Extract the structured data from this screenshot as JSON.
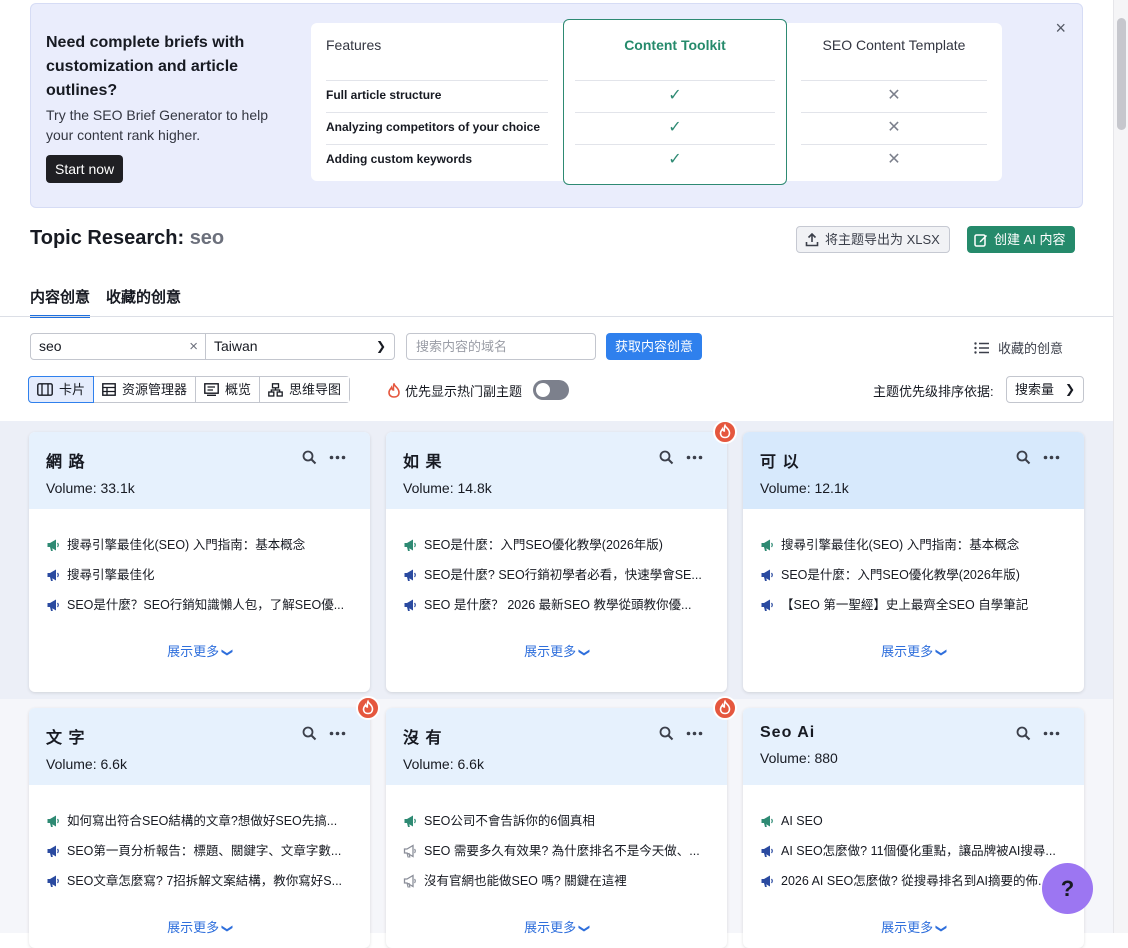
{
  "banner": {
    "headline": "Need complete briefs with customization and article outlines?",
    "sub": "Try the SEO Brief Generator to help your content rank higher.",
    "start_label": "Start now",
    "close": "×",
    "compare": {
      "features_header": "Features",
      "toolkit_header": "Content Toolkit",
      "template_header": "SEO Content Template",
      "rows": [
        "Full article structure",
        "Analyzing competitors of your choice",
        "Adding custom keywords"
      ],
      "check": "✓",
      "cross": "✕"
    }
  },
  "title": {
    "prefix": "Topic Research:",
    "keyword": "seo"
  },
  "actions": {
    "export_label": "将主题导出为 XLSX",
    "create_label": "创建 AI 内容"
  },
  "tabs": [
    "内容创意",
    "收藏的创意"
  ],
  "filters": {
    "search_value": "seo",
    "clear": "×",
    "country": "Taiwan",
    "domain_placeholder": "搜索内容的域名",
    "get_label": "获取内容创意",
    "saved_label": "收藏的创意"
  },
  "views": [
    "卡片",
    "资源管理器",
    "概览",
    "思维导图"
  ],
  "hot_label": "优先显示热门副主题",
  "sort": {
    "label": "主题优先级排序依据:",
    "value": "搜索量"
  },
  "show_more": "展示更多",
  "cards": [
    {
      "topic": "網 路",
      "volume": "Volume: 33.1k",
      "items": [
        "搜尋引擎最佳化(SEO) 入門指南：基本概念",
        "搜尋引擎最佳化",
        "SEO是什麼？SEO行銷知識懶人包，了解SEO優..."
      ]
    },
    {
      "topic": "如 果",
      "volume": "Volume: 14.8k",
      "items": [
        "SEO是什麼：入門SEO優化教學(2026年版)",
        "SEO是什麼? SEO行銷初學者必看，快速學會SE...",
        "SEO 是什麼？ 2026 最新SEO 教學從頭教你優..."
      ]
    },
    {
      "topic": "可 以",
      "volume": "Volume: 12.1k",
      "items": [
        "搜尋引擎最佳化(SEO) 入門指南：基本概念",
        "SEO是什麼：入門SEO優化教學(2026年版)",
        "【SEO 第一聖經】史上最齊全SEO 自學筆記"
      ]
    },
    {
      "topic": "文 字",
      "volume": "Volume: 6.6k",
      "items": [
        "如何寫出符合SEO結構的文章?想做好SEO先搞...",
        "SEO第一頁分析報告：標題、關鍵字、文章字數...",
        "SEO文章怎麼寫? 7招拆解文案結構，教你寫好S..."
      ]
    },
    {
      "topic": "沒 有",
      "volume": "Volume: 6.6k",
      "items": [
        "SEO公司不會告訴你的6個真相",
        "SEO 需要多久有效果? 為什麼排名不是今天做、...",
        "沒有官網也能做SEO 嗎? 關鍵在這裡"
      ]
    },
    {
      "topic": "Seo Ai",
      "volume": "Volume: 880",
      "items": [
        "AI SEO",
        "AI SEO怎麼做? 11個優化重點，讓品牌被AI搜尋...",
        "2026 AI SEO怎麼做? 從搜尋排名到AI摘要的佈..."
      ]
    }
  ],
  "help": "?",
  "colors": {
    "accent_blue": "#2f80ed",
    "accent_green": "#258a6b",
    "hot": "#e5573e",
    "mega_green": "#2e8a73",
    "mega_blue": "#2a4aa0"
  }
}
